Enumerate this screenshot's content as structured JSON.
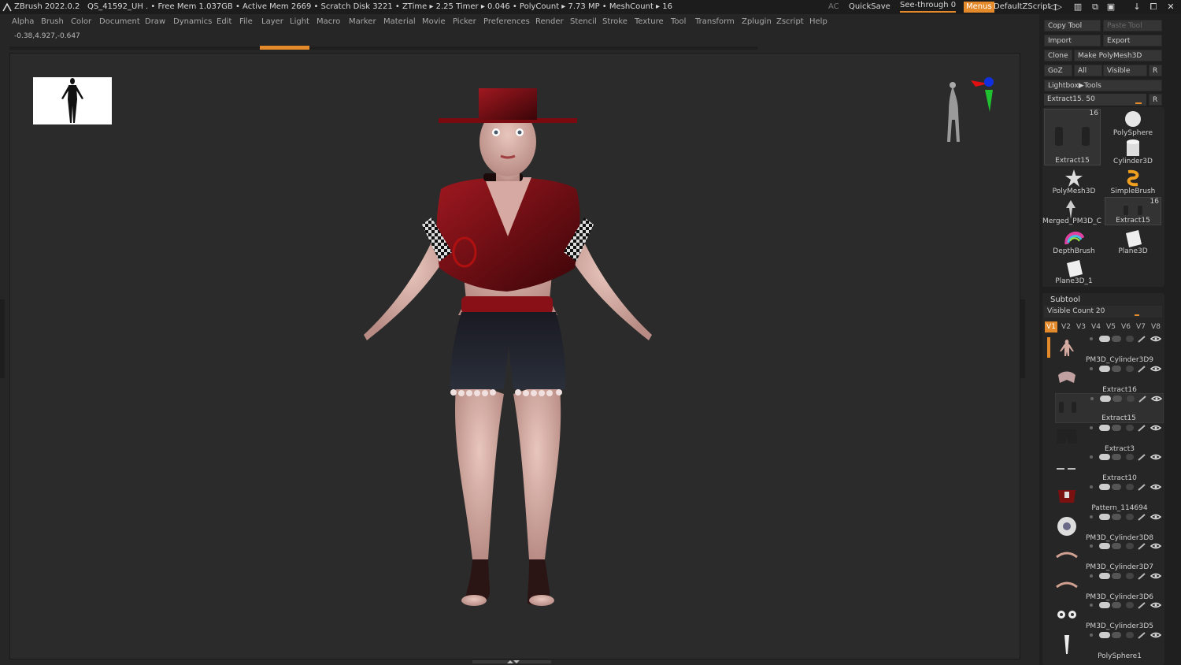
{
  "app": {
    "title": "ZBrush 2022.0.2",
    "status": "QS_41592_UH   . • Free Mem 1.037GB • Active Mem 2669 • Scratch Disk 3221 • ZTime ▸ 2.25 Timer ▸ 0.046 • PolyCount ▸ 7.73 MP • MeshCount ▸ 16",
    "right": {
      "ac": "AC",
      "quicksave": "QuickSave",
      "seethrough": "See-through  0",
      "menus": "Menus",
      "script": "DefaultZScript"
    }
  },
  "menu": [
    "Alpha",
    "Brush",
    "Color",
    "Document",
    "Draw",
    "Dynamics",
    "Edit",
    "File",
    "Layer",
    "Light",
    "Macro",
    "Marker",
    "Material",
    "Movie",
    "Picker",
    "Preferences",
    "Render",
    "Stencil",
    "Stroke",
    "Texture",
    "Tool",
    "Transform",
    "Zplugin",
    "Zscript",
    "Help"
  ],
  "coords": "-0.38,4.927,-0.647",
  "tool_panel": {
    "copy_tool": "Copy Tool",
    "paste_tool": "Paste Tool",
    "import": "Import",
    "export": "Export",
    "clone": "Clone",
    "make_polymesh": "Make PolyMesh3D",
    "goz": "GoZ",
    "all": "All",
    "visible": "Visible",
    "r": "R",
    "lightbox": "Lightbox▶Tools",
    "extract_slider": "Extract15. 50",
    "tools": [
      {
        "label": "Extract15",
        "count": "16",
        "icon": "extract-icon"
      },
      {
        "label": "PolySphere",
        "icon": "sphere-icon"
      },
      {
        "label": "Cylinder3D",
        "icon": "cylinder-icon"
      },
      {
        "label": "PolyMesh3D",
        "icon": "star-icon"
      },
      {
        "label": "SimpleBrush",
        "icon": "simplebrush-icon"
      },
      {
        "label": "Merged_PM3D_C",
        "icon": "merged-icon"
      },
      {
        "label": "Extract15",
        "count": "16",
        "icon": "extract-icon"
      },
      {
        "label": "DepthBrush",
        "icon": "depthbrush-icon"
      },
      {
        "label": "Plane3D",
        "icon": "plane-icon"
      },
      {
        "label": "Plane3D_1",
        "icon": "plane-icon"
      }
    ]
  },
  "subtool": {
    "header": "Subtool",
    "visible_count": "Visible Count 20",
    "visible_fraction": 0.55,
    "vtabs": [
      "V1",
      "V2",
      "V3",
      "V4",
      "V5",
      "V6",
      "V7",
      "V8"
    ],
    "rows": [
      {
        "name": "PM3D_Cylinder3D9",
        "thumb": "body"
      },
      {
        "name": "Extract16",
        "thumb": "top"
      },
      {
        "name": "Extract15",
        "thumb": "boots",
        "selected": true
      },
      {
        "name": "Extract3",
        "thumb": "shorts"
      },
      {
        "name": "Extract10",
        "thumb": "line"
      },
      {
        "name": "Pattern_114694",
        "thumb": "shirt"
      },
      {
        "name": "PM3D_Cylinder3D8",
        "thumb": "eye"
      },
      {
        "name": "PM3D_Cylinder3D7",
        "thumb": "brow"
      },
      {
        "name": "PM3D_Cylinder3D6",
        "thumb": "brow"
      },
      {
        "name": "PM3D_Cylinder3D5",
        "thumb": "eyes"
      },
      {
        "name": "PolySphere1",
        "thumb": "tooth"
      }
    ]
  },
  "colors": {
    "accent": "#e58a2a",
    "background": "#262626",
    "panel": "#1f1f1f"
  }
}
